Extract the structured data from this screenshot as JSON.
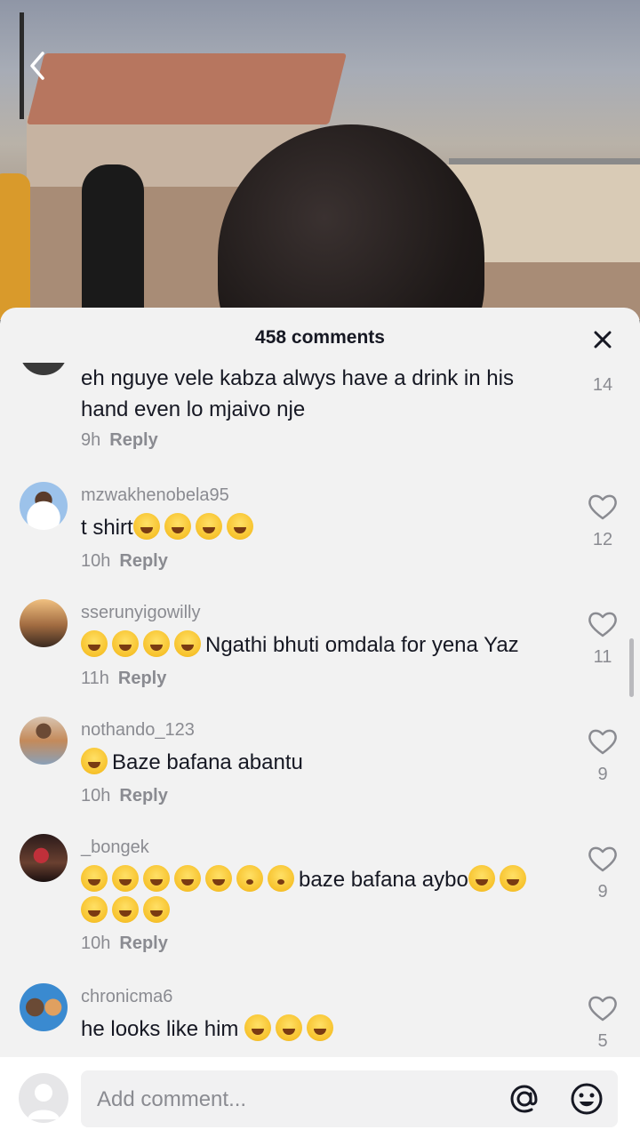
{
  "header": {
    "comment_count": "458 comments"
  },
  "comments": [
    {
      "username": "",
      "text": "eh nguye vele kabza alwys have a drink in his hand even lo mjaivo nje",
      "time": "9h",
      "reply_label": "Reply",
      "likes": "14"
    },
    {
      "username": "mzwakhenobela95",
      "text_prefix": "t shirt",
      "text_suffix": "",
      "emojis": [
        "grinning-sweat",
        "grinning-sweat",
        "grinning-sweat",
        "grinning-sweat"
      ],
      "time": "10h",
      "reply_label": "Reply",
      "likes": "12"
    },
    {
      "username": "sserunyigowilly",
      "text_prefix": "",
      "text_suffix": "Ngathi bhuti omdala for yena Yaz",
      "emojis": [
        "joy",
        "joy",
        "joy",
        "joy"
      ],
      "time": "11h",
      "reply_label": "Reply",
      "likes": "11"
    },
    {
      "username": "nothando_123",
      "text_suffix": "Baze bafana abantu",
      "emojis": [
        "rofl"
      ],
      "time": "10h",
      "reply_label": "Reply",
      "likes": "9"
    },
    {
      "username": "_bongek",
      "text_middle": "baze bafana aybo",
      "emojis_before": [
        "joy",
        "joy",
        "joy",
        "joy",
        "joy",
        "flushed",
        "flushed"
      ],
      "emojis_after": [
        "joy",
        "joy"
      ],
      "emojis_line2": [
        "joy",
        "joy",
        "joy"
      ],
      "time": "10h",
      "reply_label": "Reply",
      "likes": "9"
    },
    {
      "username": "chronicma6",
      "text_prefix": "he looks like him ",
      "emojis": [
        "joy",
        "joy",
        "joy"
      ],
      "likes": "5"
    }
  ],
  "composer": {
    "placeholder": "Add comment..."
  },
  "colors": {
    "panel_bg": "#f2f2f2",
    "text_primary": "#161823",
    "text_secondary": "#8a8b91"
  }
}
